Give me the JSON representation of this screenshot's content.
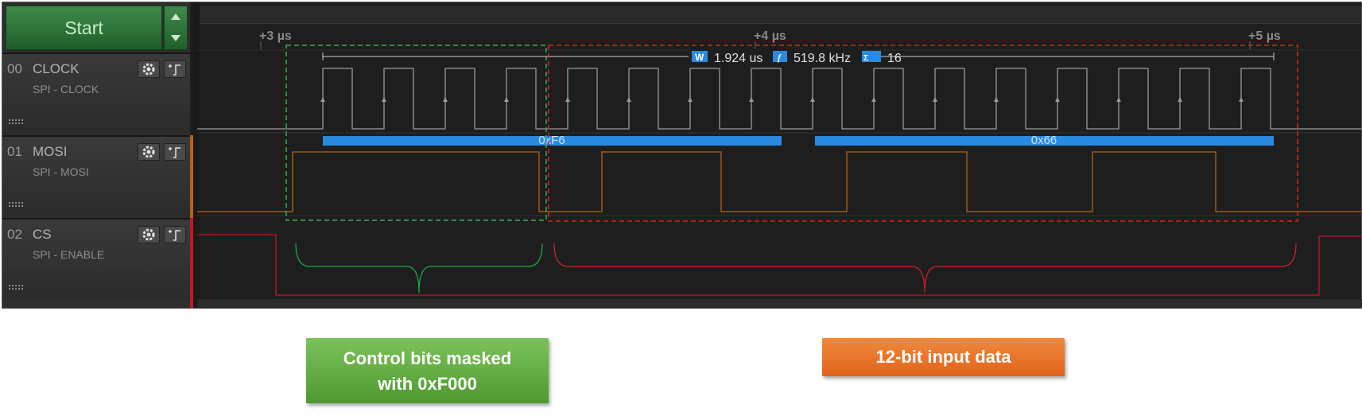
{
  "toolbar": {
    "start_label": "Start"
  },
  "timeline": {
    "ticks": [
      "+3 µs",
      "+4 µs",
      "+5 µs"
    ]
  },
  "measurement": {
    "width": "1.924 us",
    "frequency": "519.8 kHz",
    "count": "16"
  },
  "channels": [
    {
      "num": "00",
      "name": "CLOCK",
      "subtitle": "SPI - CLOCK",
      "color": "#8e8e8e"
    },
    {
      "num": "01",
      "name": "MOSI",
      "subtitle": "SPI - MOSI",
      "color": "#b4621a"
    },
    {
      "num": "02",
      "name": "CS",
      "subtitle": "SPI - ENABLE",
      "color": "#c4162a"
    }
  ],
  "decoder": {
    "bytes": [
      "0xF6",
      "0x66"
    ],
    "color": "#2a8ae0"
  },
  "annotations": {
    "control": {
      "label_line1": "Control bits masked",
      "label_line2": "with 0xF000",
      "color": "#34b05a"
    },
    "input": {
      "label": "12-bit input data",
      "color": "#e0201e"
    }
  },
  "colors": {
    "background": "#1e1e1e",
    "clock": "#9a9a9a",
    "mosi": "#b4621a",
    "cs": "#c4162a"
  }
}
